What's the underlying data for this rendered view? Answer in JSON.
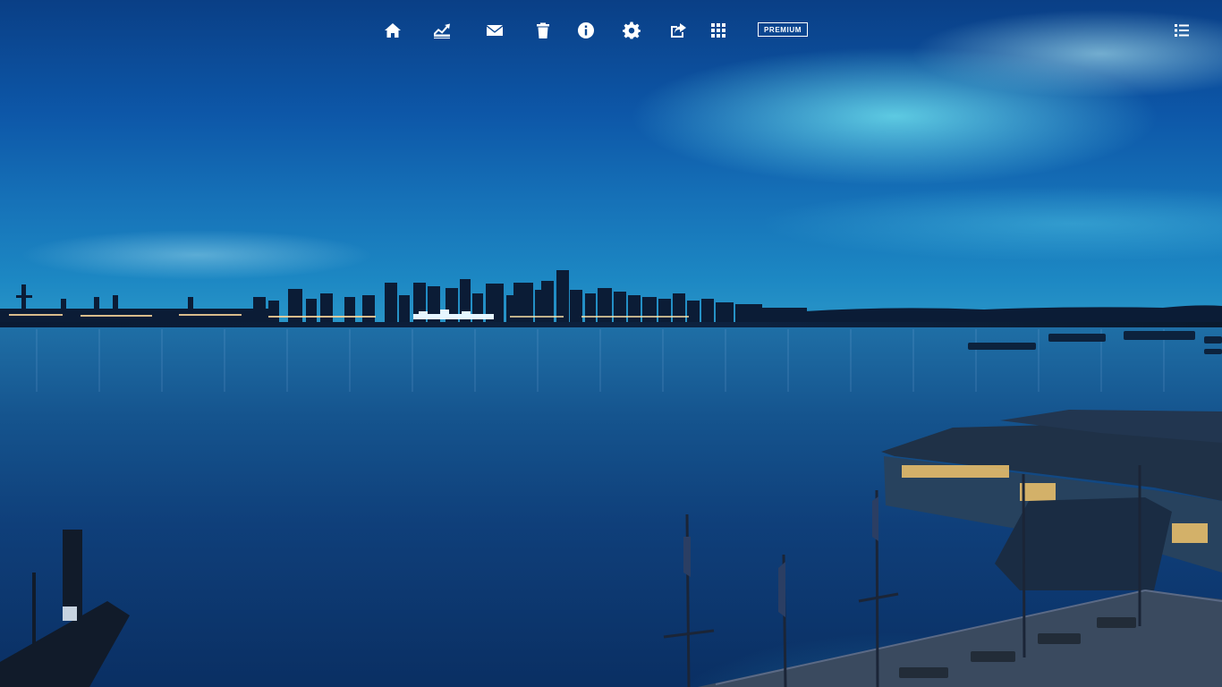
{
  "toolbar": {
    "buttons": [
      {
        "id": "home",
        "icon": "home-icon"
      },
      {
        "id": "stats",
        "icon": "stats-chart-icon"
      },
      {
        "id": "mail",
        "icon": "mail-icon"
      },
      {
        "id": "trash",
        "icon": "trash-icon"
      },
      {
        "id": "info",
        "icon": "info-icon"
      },
      {
        "id": "settings",
        "icon": "gear-icon"
      },
      {
        "id": "share",
        "icon": "share-icon"
      },
      {
        "id": "apps",
        "icon": "grid-icon"
      }
    ],
    "premium_label": "PREMIUM",
    "menu_icon": "list-menu-icon"
  },
  "wallpaper": {
    "scene": "city-skyline-waterfront-dusk",
    "colors": {
      "sky_top": "#0a3f86",
      "sky_glow": "#78f0f5",
      "water": "#0f3f7a",
      "toolbar_fg": "#ffffff"
    }
  }
}
